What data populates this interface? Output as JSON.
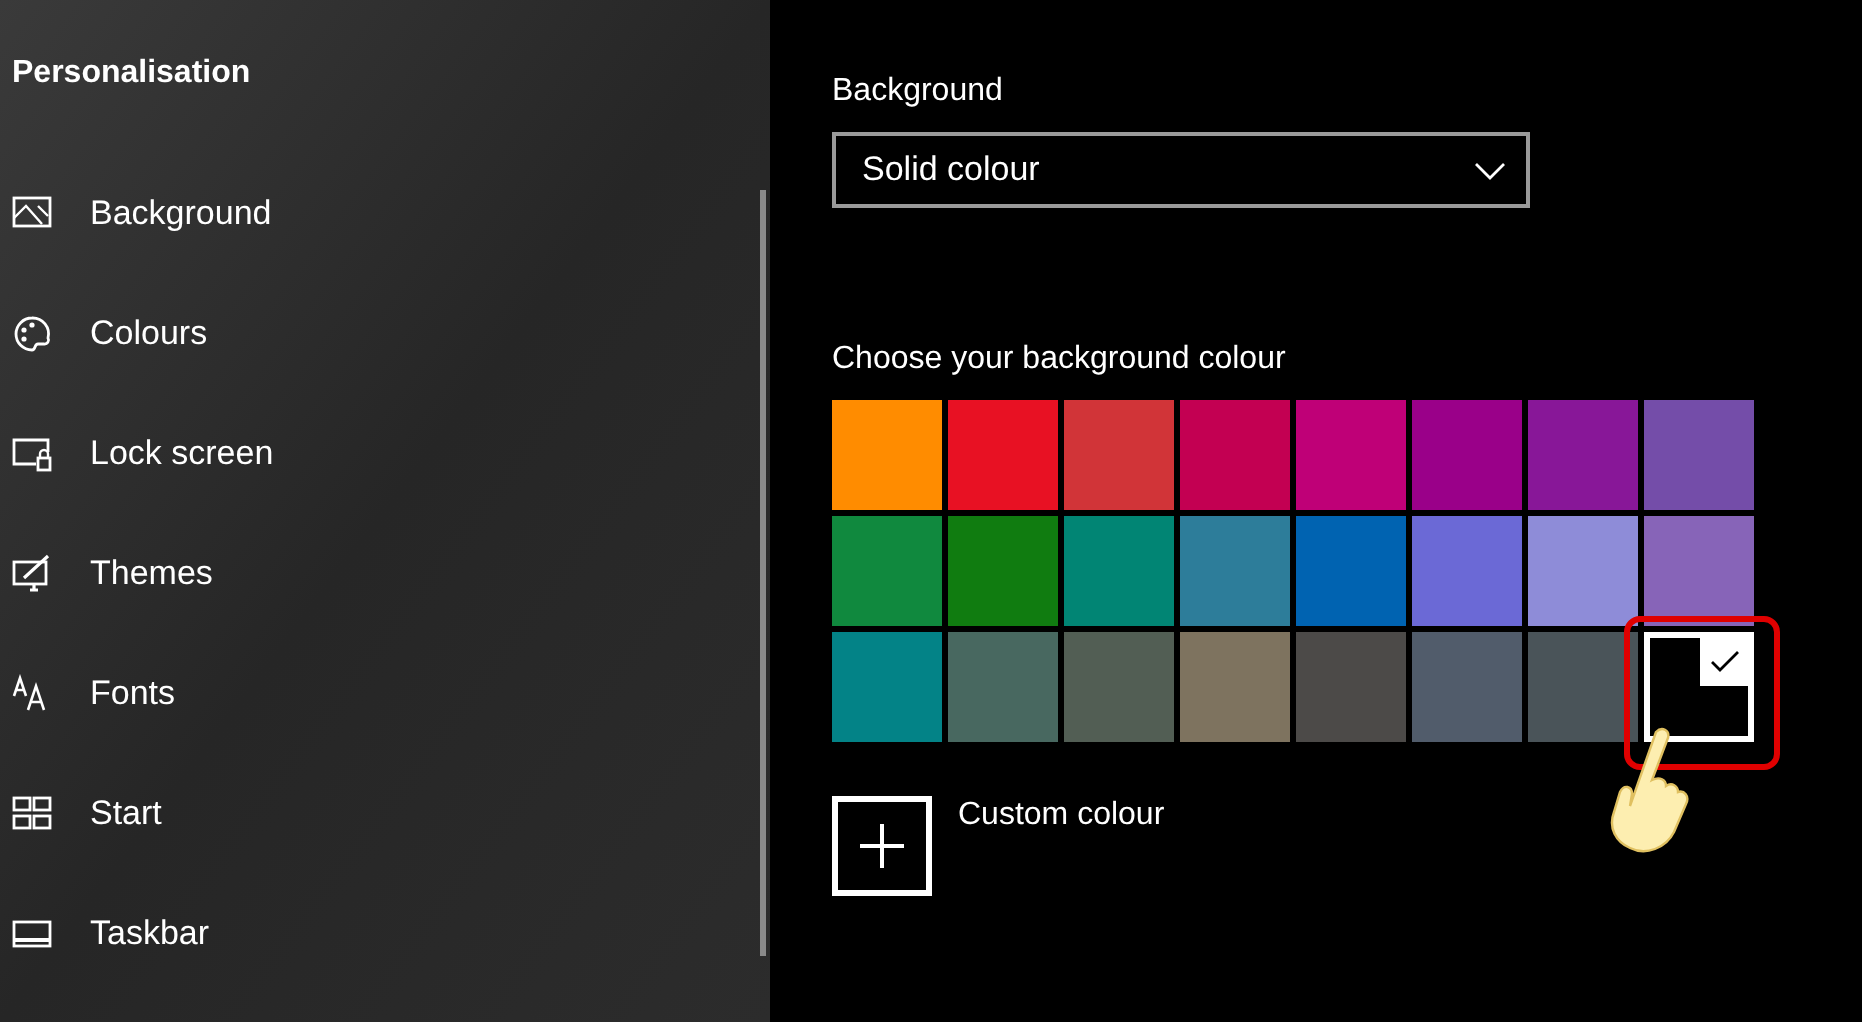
{
  "sidebar": {
    "title": "Personalisation",
    "items": [
      {
        "label": "Background"
      },
      {
        "label": "Colours"
      },
      {
        "label": "Lock screen"
      },
      {
        "label": "Themes"
      },
      {
        "label": "Fonts"
      },
      {
        "label": "Start"
      },
      {
        "label": "Taskbar"
      }
    ]
  },
  "background": {
    "label": "Background",
    "dropdown": {
      "value": "Solid colour"
    }
  },
  "colour_picker": {
    "label": "Choose your background colour",
    "swatches": [
      {
        "color": "#ff8c00",
        "selected": false
      },
      {
        "color": "#e81123",
        "selected": false
      },
      {
        "color": "#d13438",
        "selected": false
      },
      {
        "color": "#c30052",
        "selected": false
      },
      {
        "color": "#bf0077",
        "selected": false
      },
      {
        "color": "#9a0089",
        "selected": false
      },
      {
        "color": "#881798",
        "selected": false
      },
      {
        "color": "#744da9",
        "selected": false
      },
      {
        "color": "#10893e",
        "selected": false
      },
      {
        "color": "#107c10",
        "selected": false
      },
      {
        "color": "#018574",
        "selected": false
      },
      {
        "color": "#2d7d9a",
        "selected": false
      },
      {
        "color": "#0063b1",
        "selected": false
      },
      {
        "color": "#6b69d6",
        "selected": false
      },
      {
        "color": "#8e8cd8",
        "selected": false
      },
      {
        "color": "#8764b8",
        "selected": false
      },
      {
        "color": "#038387",
        "selected": false
      },
      {
        "color": "#486860",
        "selected": false
      },
      {
        "color": "#525e54",
        "selected": false
      },
      {
        "color": "#7e735f",
        "selected": false
      },
      {
        "color": "#4c4a48",
        "selected": false
      },
      {
        "color": "#515c6b",
        "selected": false
      },
      {
        "color": "#4a5459",
        "selected": false
      },
      {
        "color": "#000000",
        "selected": true
      }
    ],
    "custom": {
      "label": "Custom colour"
    }
  }
}
